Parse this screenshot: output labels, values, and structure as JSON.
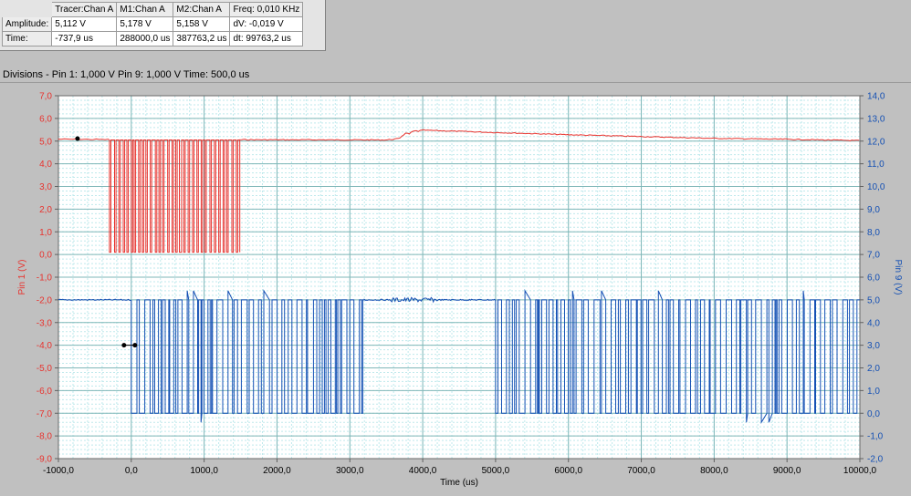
{
  "readout": {
    "headers": [
      "Tracer:Chan A",
      "M1:Chan A",
      "M2:Chan A",
      "Freq: 0,010 KHz"
    ],
    "amplitude": {
      "label": "Amplitude:",
      "tracer": "5,112 V",
      "m1": "5,178 V",
      "m2": "5,158 V",
      "extra": "dV: -0,019 V"
    },
    "time": {
      "label": "Time:",
      "tracer": "-737,9 us",
      "m1": "288000,0 us",
      "m2": "387763,2 us",
      "extra": "dt:  99763,2 us"
    }
  },
  "divisions_text": "Divisions -  Pin 1: 1,000 V    Pin 9: 1,000 V    Time: 500,0 us",
  "chart_data": {
    "type": "line",
    "title": "",
    "xlabel": "Time (us)",
    "ylabel_left": "Pin 1 (V)",
    "ylabel_right": "Pin 9 (V)",
    "xlim": [
      -1000,
      10000
    ],
    "ylim_left": [
      -9,
      7
    ],
    "ylim_right": [
      -2,
      14
    ],
    "x_ticks": [
      "-1000,0",
      "0,0",
      "1000,0",
      "2000,0",
      "3000,0",
      "4000,0",
      "5000,0",
      "6000,0",
      "7000,0",
      "8000,0",
      "9000,0",
      "10000,0"
    ],
    "y_ticks_left": [
      "7,0",
      "6,0",
      "5,0",
      "4,0",
      "3,0",
      "2,0",
      "1,0",
      "0,0",
      "-1,0",
      "-2,0",
      "-3,0",
      "-4,0",
      "-5,0",
      "-6,0",
      "-7,0",
      "-8,0",
      "-9,0"
    ],
    "y_ticks_right": [
      "14,0",
      "13,0",
      "12,0",
      "11,0",
      "10,0",
      "9,0",
      "8,0",
      "7,0",
      "6,0",
      "5,0",
      "4,0",
      "3,0",
      "2,0",
      "1,0",
      "0,0",
      "-1,0",
      "-2,0"
    ],
    "grid": true,
    "series": [
      {
        "name": "Pin 1",
        "axis": "left",
        "color": "#e8322d",
        "high": 5.05,
        "low": 0.1,
        "toggle_times": [
          -300,
          -280,
          -230,
          -210,
          -170,
          -150,
          -110,
          -90,
          -60,
          -40,
          0,
          20,
          40,
          60,
          100,
          120,
          150,
          170,
          200,
          220,
          260,
          280,
          330,
          350,
          380,
          400,
          430,
          450,
          500,
          520,
          560,
          580,
          610,
          630,
          660,
          690,
          720,
          740,
          780,
          800,
          840,
          860,
          900,
          920,
          960,
          980,
          1010,
          1030,
          1080,
          1100,
          1140,
          1160,
          1200,
          1220,
          1260,
          1280,
          1310,
          1330,
          1380,
          1400,
          1440,
          1460,
          1490
        ],
        "envelope": [
          [
            -1000,
            5.08
          ],
          [
            -300,
            5.07
          ],
          [
            1500,
            5.06
          ],
          [
            3500,
            5.05
          ],
          [
            3650,
            5.1
          ],
          [
            3800,
            5.35
          ],
          [
            4000,
            5.48
          ],
          [
            4300,
            5.45
          ],
          [
            5000,
            5.38
          ],
          [
            6000,
            5.28
          ],
          [
            7000,
            5.2
          ],
          [
            8000,
            5.12
          ],
          [
            9000,
            5.08
          ],
          [
            10000,
            5.02
          ]
        ]
      },
      {
        "name": "Pin 9",
        "axis": "right",
        "color": "#1450b4",
        "high": 5.0,
        "low": 0.0,
        "active_ranges": [
          [
            0,
            3200
          ],
          [
            5000,
            10000
          ]
        ],
        "flat_level": 5.0
      }
    ],
    "cursors": [
      {
        "series": "Pin 1",
        "x": -737.9,
        "y": 5.112
      },
      {
        "series": "Pin 9",
        "x": -100,
        "y": 3.0
      },
      {
        "series": "Pin 9",
        "x": 50,
        "y": 3.0
      }
    ]
  }
}
